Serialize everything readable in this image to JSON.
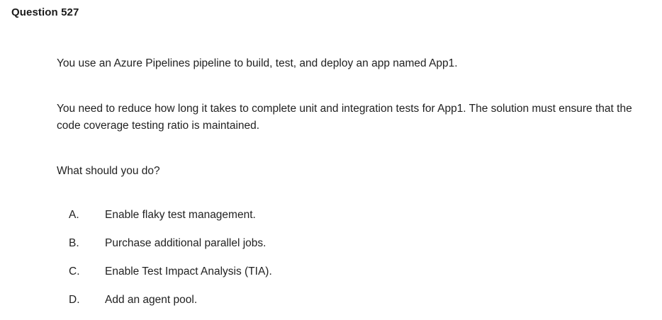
{
  "question": {
    "title": "Question 527",
    "paragraphs": [
      "You use an Azure Pipelines pipeline to build, test, and deploy an app named App1.",
      "You need to reduce how long it takes to complete unit and integration tests for App1. The solution must ensure that the code coverage testing ratio is maintained.",
      "What should you do?"
    ],
    "options": [
      {
        "letter": "A.",
        "text": "Enable flaky test management."
      },
      {
        "letter": "B.",
        "text": "Purchase additional parallel jobs."
      },
      {
        "letter": "C.",
        "text": "Enable Test Impact Analysis (TIA)."
      },
      {
        "letter": "D.",
        "text": "Add an agent pool."
      }
    ]
  }
}
